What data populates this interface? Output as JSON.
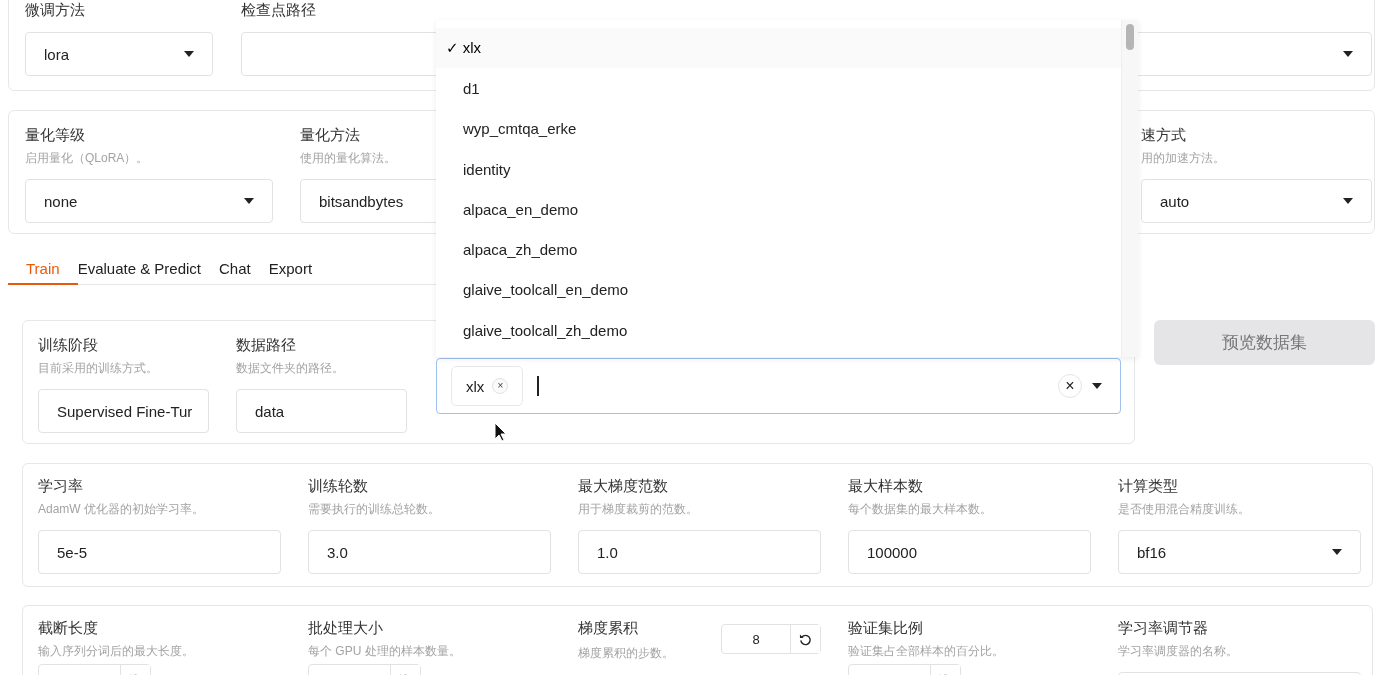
{
  "top_row": [
    {
      "label": "微调方法",
      "kind": "select",
      "value": "lora"
    },
    {
      "label": "检查点路径",
      "kind": "select"
    }
  ],
  "quant_row": [
    {
      "label": "量化等级",
      "hint": "启用量化（QLoRA）。",
      "kind": "select",
      "value": "none"
    },
    {
      "label": "量化方法",
      "hint": "使用的量化算法。",
      "kind": "select",
      "value": "bitsandbytes"
    },
    {
      "label": "速方式",
      "hint": "用的加速方法。",
      "kind": "select",
      "value": "auto"
    }
  ],
  "tabs": [
    {
      "label": "Train",
      "selected": true
    },
    {
      "label": "Evaluate & Predict",
      "selected": false
    },
    {
      "label": "Chat",
      "selected": false
    },
    {
      "label": "Export",
      "selected": false
    }
  ],
  "data_row": [
    {
      "label": "训练阶段",
      "hint": "目前采用的训练方式。",
      "kind": "text",
      "value": "Supervised Fine-Tur"
    },
    {
      "label": "数据路径",
      "hint": "数据文件夹的路径。",
      "kind": "text",
      "value": "data"
    }
  ],
  "dataset_select": {
    "chips": [
      {
        "label": "xlx",
        "remove": "×"
      }
    ],
    "clear": "×"
  },
  "preview_button": {
    "label": "预览数据集",
    "disabled": true
  },
  "train_row": [
    {
      "label": "学习率",
      "hint": "AdamW 优化器的初始学习率。",
      "kind": "text",
      "value": "5e-5"
    },
    {
      "label": "训练轮数",
      "hint": "需要执行的训练总轮数。",
      "kind": "text",
      "value": "3.0"
    },
    {
      "label": "最大梯度范数",
      "hint": "用于梯度裁剪的范数。",
      "kind": "text",
      "value": "1.0"
    },
    {
      "label": "最大样本数",
      "hint": "每个数据集的最大样本数。",
      "kind": "text",
      "value": "100000"
    },
    {
      "label": "计算类型",
      "hint": "是否使用混合精度训练。",
      "kind": "select",
      "value": "bf16"
    }
  ],
  "slider_row": [
    {
      "label": "截断长度",
      "hint": "输入序列分词后的最大长度。",
      "kind": "number"
    },
    {
      "label": "批处理大小",
      "hint": "每个 GPU 处理的样本数量。",
      "kind": "number"
    },
    {
      "label": "梯度累积",
      "hint": "梯度累积的步数。",
      "kind": "number-inline",
      "value": "8"
    },
    {
      "label": "验证集比例",
      "hint": "验证集占全部样本的百分比。",
      "kind": "number"
    },
    {
      "label": "学习率调节器",
      "hint": "学习率调度器的名称。",
      "kind": "select"
    }
  ],
  "dataset_menu": {
    "items": [
      {
        "label": "xlx",
        "selected": true,
        "check": "✓"
      },
      {
        "label": "d1",
        "selected": false
      },
      {
        "label": "wyp_cmtqa_erke",
        "selected": false
      },
      {
        "label": "identity",
        "selected": false
      },
      {
        "label": "alpaca_en_demo",
        "selected": false
      },
      {
        "label": "alpaca_zh_demo",
        "selected": false
      },
      {
        "label": "glaive_toolcall_en_demo",
        "selected": false
      },
      {
        "label": "glaive_toolcall_zh_demo",
        "selected": false
      }
    ]
  }
}
